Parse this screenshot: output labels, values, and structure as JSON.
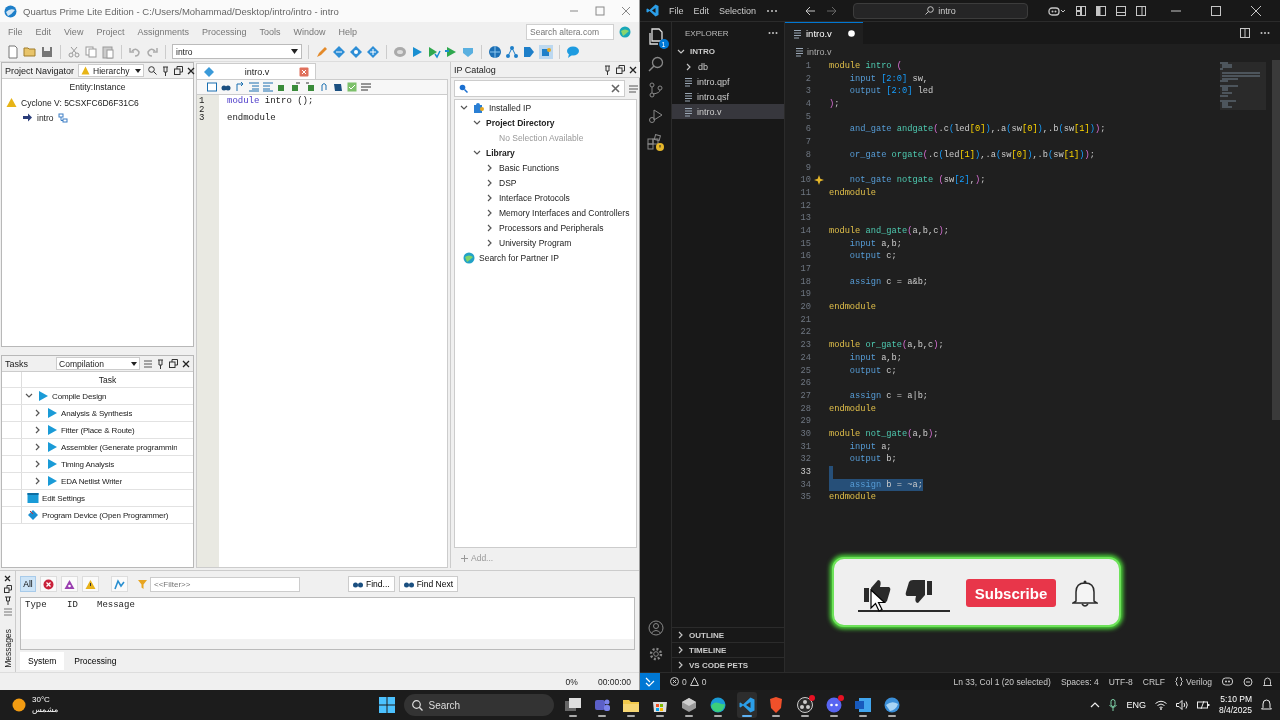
{
  "quartus": {
    "title": "Quartus Prime Lite Edition - C:/Users/Mohammad/Desktop/intro/intro - intro",
    "menu": [
      "File",
      "Edit",
      "View",
      "Project",
      "Assignments",
      "Processing",
      "Tools",
      "Window",
      "Help"
    ],
    "search": {
      "placeholder": "Search altera.com"
    },
    "revision": "intro",
    "project_navigator": {
      "title": "Project Navigator",
      "view": "Hierarchy",
      "column": "Entity:Instance",
      "tree": [
        {
          "label": "Cyclone V: 5CSXFC6D6F31C6",
          "kind": "device",
          "children": [
            {
              "label": "intro",
              "kind": "entity"
            }
          ]
        }
      ]
    },
    "tasks": {
      "title": "Tasks",
      "flow": "Compilation",
      "column": "Task",
      "items": [
        {
          "label": "Compile Design",
          "kind": "flow",
          "expanded": true,
          "children": [
            {
              "label": "Analysis & Synthesis",
              "kind": "flow",
              "expanded": false
            },
            {
              "label": "Fitter (Place & Route)",
              "kind": "flow",
              "expanded": false
            },
            {
              "label": "Assembler (Generate programmin",
              "kind": "flow",
              "expanded": false
            },
            {
              "label": "Timing Analysis",
              "kind": "flow",
              "expanded": false
            },
            {
              "label": "EDA Netlist Writer",
              "kind": "flow",
              "expanded": false
            }
          ]
        },
        {
          "label": "Edit Settings",
          "kind": "settings"
        },
        {
          "label": "Program Device (Open Programmer)",
          "kind": "programmer"
        }
      ]
    },
    "editor": {
      "tab": "intro.v",
      "lines": [
        {
          "num": "1",
          "tokens": [
            {
              "kind": "keyword",
              "text": "module"
            },
            {
              "kind": "plain",
              "text": " intro ();"
            }
          ]
        },
        {
          "num": "2"
        },
        {
          "num": "3",
          "tokens": [
            {
              "kind": "plain",
              "text": "endmodule"
            }
          ]
        }
      ]
    },
    "ip_catalog": {
      "title": "IP Catalog",
      "add": "Add...",
      "tree": [
        {
          "label": "Installed IP",
          "kind": "installed",
          "expanded": true,
          "children": [
            {
              "label": "Project Directory",
              "kind": "group",
              "expanded": true,
              "children": [
                {
                  "label": "No Selection Available",
                  "kind": "note"
                }
              ]
            },
            {
              "label": "Library",
              "kind": "group",
              "expanded": true,
              "children": [
                {
                  "label": "Basic Functions",
                  "kind": "category",
                  "expanded": false
                },
                {
                  "label": "DSP",
                  "kind": "category",
                  "expanded": false
                },
                {
                  "label": "Interface Protocols",
                  "kind": "category",
                  "expanded": false
                },
                {
                  "label": "Memory Interfaces and Controllers",
                  "kind": "category",
                  "expanded": false
                },
                {
                  "label": "Processors and Peripherals",
                  "kind": "category",
                  "expanded": false
                },
                {
                  "label": "University Program",
                  "kind": "category",
                  "expanded": false
                }
              ]
            }
          ]
        },
        {
          "label": "Search for Partner IP",
          "kind": "partner"
        }
      ]
    },
    "messages": {
      "label": "Messages",
      "filters": [
        {
          "kind": "all",
          "label": "All",
          "selected": true
        },
        {
          "kind": "error",
          "selected": false
        },
        {
          "kind": "critical",
          "selected": false
        },
        {
          "kind": "warning",
          "selected": false
        },
        {
          "kind": "suppressed",
          "selected": false
        }
      ],
      "filter": {
        "placeholder": "<<Filter>>"
      },
      "find": "Find...",
      "find_next": "Find Next",
      "columns": [
        "Type",
        "ID",
        "Message"
      ],
      "tabs": [
        {
          "label": "System",
          "selected": true
        },
        {
          "label": "Processing",
          "selected": false
        }
      ]
    },
    "status": {
      "progress": "0%",
      "elapsed": "00:00:00"
    }
  },
  "vscode": {
    "menu": [
      "File",
      "Edit",
      "Selection"
    ],
    "search": "intro",
    "explorer_badge": "1",
    "explorer": {
      "title": "EXPLORER",
      "folder": {
        "label": "INTRO",
        "expanded": true
      },
      "items": [
        {
          "label": "db",
          "kind": "folder",
          "expanded": false,
          "selected": false
        },
        {
          "label": "intro.qpf",
          "kind": "file",
          "selected": false
        },
        {
          "label": "intro.qsf",
          "kind": "file",
          "selected": false
        },
        {
          "label": "intro.v",
          "kind": "file",
          "selected": true
        }
      ],
      "sections": [
        {
          "label": "OUTLINE",
          "expanded": false
        },
        {
          "label": "TIMELINE",
          "expanded": false
        },
        {
          "label": "VS CODE PETS",
          "expanded": false
        }
      ]
    },
    "tab": {
      "label": "intro.v",
      "modified": true
    },
    "breadcrumb": "intro.v",
    "editor": {
      "lines": [
        {
          "num": "1",
          "selected": false,
          "hint": false,
          "tokens": [
            {
              "kind": "keyword",
              "text": "module"
            },
            {
              "kind": "name",
              "text": " intro"
            },
            {
              "kind": "bracket1",
              "text": " ("
            }
          ]
        },
        {
          "num": "2",
          "selected": false,
          "hint": false,
          "tokens": [
            {
              "kind": "type",
              "text": "    input"
            },
            {
              "kind": "bracket2",
              "text": " [2:0]"
            },
            {
              "kind": "plain",
              "text": " sw,"
            }
          ]
        },
        {
          "num": "3",
          "selected": false,
          "hint": false,
          "tokens": [
            {
              "kind": "type",
              "text": "    output"
            },
            {
              "kind": "bracket2",
              "text": " [2:0]"
            },
            {
              "kind": "plain",
              "text": " led"
            }
          ]
        },
        {
          "num": "4",
          "selected": false,
          "hint": false,
          "tokens": [
            {
              "kind": "bracket1",
              "text": ")"
            },
            {
              "kind": "plain",
              "text": ";"
            }
          ]
        },
        {
          "num": "5",
          "selected": false,
          "hint": false
        },
        {
          "num": "6",
          "selected": false,
          "hint": false,
          "tokens": [
            {
              "kind": "type",
              "text": "    and_gate"
            },
            {
              "kind": "name",
              "text": " andgate"
            },
            {
              "kind": "bracket1",
              "text": "("
            },
            {
              "kind": "plain",
              "text": ".c"
            },
            {
              "kind": "bracket2",
              "text": "("
            },
            {
              "kind": "plain",
              "text": "led"
            },
            {
              "kind": "bracket3",
              "text": "[0]"
            },
            {
              "kind": "bracket2",
              "text": ")"
            },
            {
              "kind": "plain",
              "text": ",.a"
            },
            {
              "kind": "bracket2",
              "text": "("
            },
            {
              "kind": "plain",
              "text": "sw"
            },
            {
              "kind": "bracket3",
              "text": "[0]"
            },
            {
              "kind": "bracket2",
              "text": ")"
            },
            {
              "kind": "plain",
              "text": ",.b"
            },
            {
              "kind": "bracket2",
              "text": "("
            },
            {
              "kind": "plain",
              "text": "sw"
            },
            {
              "kind": "bracket3",
              "text": "[1]"
            },
            {
              "kind": "bracket2",
              "text": ")"
            },
            {
              "kind": "bracket1",
              "text": ")"
            },
            {
              "kind": "plain",
              "text": ";"
            }
          ]
        },
        {
          "num": "7",
          "selected": false,
          "hint": false
        },
        {
          "num": "8",
          "selected": false,
          "hint": false,
          "tokens": [
            {
              "kind": "type",
              "text": "    or_gate"
            },
            {
              "kind": "name",
              "text": " orgate"
            },
            {
              "kind": "bracket1",
              "text": "("
            },
            {
              "kind": "plain",
              "text": ".c"
            },
            {
              "kind": "bracket2",
              "text": "("
            },
            {
              "kind": "plain",
              "text": "led"
            },
            {
              "kind": "bracket3",
              "text": "[1]"
            },
            {
              "kind": "bracket2",
              "text": ")"
            },
            {
              "kind": "plain",
              "text": ",.a"
            },
            {
              "kind": "bracket2",
              "text": "("
            },
            {
              "kind": "plain",
              "text": "sw"
            },
            {
              "kind": "bracket3",
              "text": "[0]"
            },
            {
              "kind": "bracket2",
              "text": ")"
            },
            {
              "kind": "plain",
              "text": ",.b"
            },
            {
              "kind": "bracket2",
              "text": "("
            },
            {
              "kind": "plain",
              "text": "sw"
            },
            {
              "kind": "bracket3",
              "text": "[1]"
            },
            {
              "kind": "bracket2",
              "text": ")"
            },
            {
              "kind": "bracket1",
              "text": ")"
            },
            {
              "kind": "plain",
              "text": ";"
            }
          ]
        },
        {
          "num": "9",
          "selected": false,
          "hint": false
        },
        {
          "num": "10",
          "selected": false,
          "hint": true,
          "tokens": [
            {
              "kind": "type",
              "text": "    not_gate"
            },
            {
              "kind": "name",
              "text": " notgate"
            },
            {
              "kind": "bracket1",
              "text": " ("
            },
            {
              "kind": "plain",
              "text": "sw"
            },
            {
              "kind": "bracket2",
              "text": "[2]"
            },
            {
              "kind": "plain",
              "text": ","
            },
            {
              "kind": "bracket1",
              "text": ")"
            },
            {
              "kind": "plain",
              "text": ";"
            }
          ]
        },
        {
          "num": "11",
          "selected": false,
          "hint": false,
          "tokens": [
            {
              "kind": "keyword",
              "text": "endmodule"
            }
          ]
        },
        {
          "num": "12",
          "selected": false,
          "hint": false
        },
        {
          "num": "13",
          "selected": false,
          "hint": false
        },
        {
          "num": "14",
          "selected": false,
          "hint": false,
          "tokens": [
            {
              "kind": "keyword",
              "text": "module"
            },
            {
              "kind": "name",
              "text": " and_gate"
            },
            {
              "kind": "bracket1",
              "text": "("
            },
            {
              "kind": "plain",
              "text": "a,b,c"
            },
            {
              "kind": "bracket1",
              "text": ")"
            },
            {
              "kind": "plain",
              "text": ";"
            }
          ]
        },
        {
          "num": "15",
          "selected": false,
          "hint": false,
          "tokens": [
            {
              "kind": "type",
              "text": "    input"
            },
            {
              "kind": "plain",
              "text": " a,b;"
            }
          ]
        },
        {
          "num": "16",
          "selected": false,
          "hint": false,
          "tokens": [
            {
              "kind": "type",
              "text": "    output"
            },
            {
              "kind": "plain",
              "text": " c;"
            }
          ]
        },
        {
          "num": "17",
          "selected": false,
          "hint": false
        },
        {
          "num": "18",
          "selected": false,
          "hint": false,
          "tokens": [
            {
              "kind": "type",
              "text": "    assign"
            },
            {
              "kind": "plain",
              "text": " c = a&b;"
            }
          ]
        },
        {
          "num": "19",
          "selected": false,
          "hint": false
        },
        {
          "num": "20",
          "selected": false,
          "hint": false,
          "tokens": [
            {
              "kind": "keyword",
              "text": "endmodule"
            }
          ]
        },
        {
          "num": "21",
          "selected": false,
          "hint": false
        },
        {
          "num": "22",
          "selected": false,
          "hint": false
        },
        {
          "num": "23",
          "selected": false,
          "hint": false,
          "tokens": [
            {
              "kind": "keyword",
              "text": "module"
            },
            {
              "kind": "name",
              "text": " or_gate"
            },
            {
              "kind": "bracket1",
              "text": "("
            },
            {
              "kind": "plain",
              "text": "a,b,c"
            },
            {
              "kind": "bracket1",
              "text": ")"
            },
            {
              "kind": "plain",
              "text": ";"
            }
          ]
        },
        {
          "num": "24",
          "selected": false,
          "hint": false,
          "tokens": [
            {
              "kind": "type",
              "text": "    input"
            },
            {
              "kind": "plain",
              "text": " a,b;"
            }
          ]
        },
        {
          "num": "25",
          "selected": false,
          "hint": false,
          "tokens": [
            {
              "kind": "type",
              "text": "    output"
            },
            {
              "kind": "plain",
              "text": " c;"
            }
          ]
        },
        {
          "num": "26",
          "selected": false,
          "hint": false
        },
        {
          "num": "27",
          "selected": false,
          "hint": false,
          "tokens": [
            {
              "kind": "type",
              "text": "    assign"
            },
            {
              "kind": "plain",
              "text": " c = a|b;"
            }
          ]
        },
        {
          "num": "28",
          "selected": false,
          "hint": false,
          "tokens": [
            {
              "kind": "keyword",
              "text": "endmodule"
            }
          ]
        },
        {
          "num": "29",
          "selected": false,
          "hint": false
        },
        {
          "num": "30",
          "selected": false,
          "hint": false,
          "tokens": [
            {
              "kind": "keyword",
              "text": "module"
            },
            {
              "kind": "name",
              "text": " not_gate"
            },
            {
              "kind": "bracket1",
              "text": "("
            },
            {
              "kind": "plain",
              "text": "a,b"
            },
            {
              "kind": "bracket1",
              "text": ")"
            },
            {
              "kind": "plain",
              "text": ";"
            }
          ]
        },
        {
          "num": "31",
          "selected": false,
          "hint": false,
          "tokens": [
            {
              "kind": "type",
              "text": "    input"
            },
            {
              "kind": "plain",
              "text": " a;"
            }
          ]
        },
        {
          "num": "32",
          "selected": false,
          "hint": false,
          "tokens": [
            {
              "kind": "type",
              "text": "    output"
            },
            {
              "kind": "plain",
              "text": " b;"
            }
          ]
        },
        {
          "num": "33",
          "selected": true,
          "hint": false
        },
        {
          "num": "34",
          "selected": true,
          "hint": false,
          "tokens": [
            {
              "kind": "type",
              "text": "    assign"
            },
            {
              "kind": "plain",
              "text": " b = ~a;"
            }
          ]
        },
        {
          "num": "35",
          "selected": false,
          "hint": false,
          "tokens": [
            {
              "kind": "keyword",
              "text": "endmodule"
            }
          ]
        }
      ]
    },
    "status": {
      "errors": "0",
      "warnings": "0",
      "position": "Ln 33, Col 1 (20 selected)",
      "indent": "Spaces: 4",
      "encoding": "UTF-8",
      "eol": "CRLF",
      "language": "Verilog"
    }
  },
  "overlay": {
    "subscribe": "Subscribe"
  },
  "taskbar": {
    "temperature": "30°C",
    "condition": "مشمس",
    "search": "Search",
    "apps": [
      {
        "kind": "taskview",
        "active": false,
        "badge": false
      },
      {
        "kind": "teams",
        "active": false,
        "badge": false
      },
      {
        "kind": "files",
        "active": false,
        "badge": false
      },
      {
        "kind": "store",
        "active": false,
        "badge": false
      },
      {
        "kind": "cube",
        "active": false,
        "badge": false
      },
      {
        "kind": "edge",
        "active": false,
        "badge": false
      },
      {
        "kind": "vscode",
        "active": true,
        "badge": false
      },
      {
        "kind": "lion",
        "active": false,
        "badge": false
      },
      {
        "kind": "record",
        "active": false,
        "badge": true
      },
      {
        "kind": "chat",
        "active": false,
        "badge": true
      },
      {
        "kind": "word",
        "active": false,
        "badge": false
      },
      {
        "kind": "orb",
        "active": false,
        "badge": false
      }
    ],
    "language": "ENG",
    "time": "5:10 PM",
    "date": "8/4/2025"
  }
}
